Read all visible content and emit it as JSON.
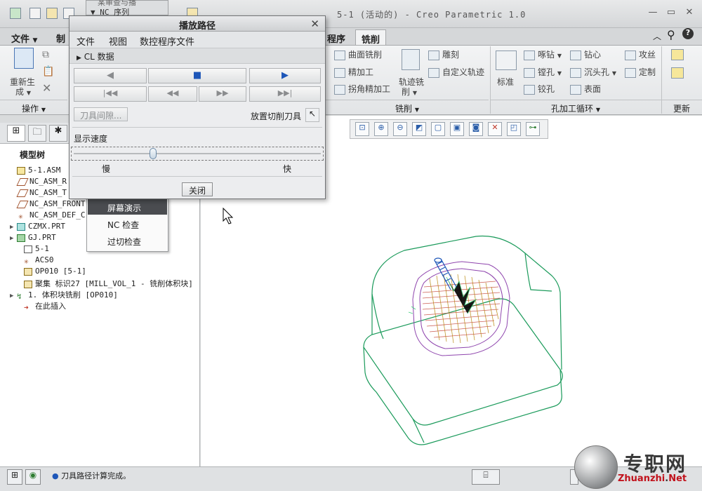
{
  "window": {
    "title": "5-1 (活动的) - Creo Parametric 1.0"
  },
  "ribbon": {
    "tabs": [
      {
        "label": "文件",
        "has_arrow": true
      },
      {
        "label": "制",
        "has_arrow": false
      },
      {
        "label": "程序",
        "has_arrow": false
      },
      {
        "label": "铣削",
        "has_arrow": false,
        "active": true
      }
    ],
    "regen_label_1": "重新生",
    "regen_label_2": "成",
    "operations_group": "操作",
    "milling_items": [
      "曲面铣削",
      "精加工",
      "拐角精加工"
    ],
    "trajectory_label_1": "轨迹铣",
    "trajectory_label_2": "削",
    "engrave_items": [
      "雕刻",
      "自定义轨迹"
    ],
    "milling_group": "铣削",
    "standard_label": "标准",
    "hole_col1": [
      "啄钻",
      "镗孔",
      "铰孔"
    ],
    "hole_col2": [
      "钻心",
      "沉头孔",
      "表面"
    ],
    "hole_col3": [
      "攻丝",
      "定制"
    ],
    "hole_group": "孔加工循环",
    "update_group": "更新"
  },
  "dialog": {
    "title": "播放路径",
    "menu": [
      "文件",
      "视图",
      "数控程序文件"
    ],
    "cl_data": "CL 数据",
    "tool_clearance": "刀具间隙...",
    "place_cutter": "放置切削刀具",
    "speed_label": "显示速度",
    "speed_slow": "慢",
    "speed_fast": "快",
    "speed_value": 0.32,
    "close": "关闭",
    "header_fragment": "NC 序列",
    "header_fragment_top": "某审查与播",
    "btn_icons": {
      "play_back": "◀",
      "stop": "■",
      "play": "▶",
      "first": "|◀◀",
      "rewind": "◀◀",
      "forward": "▶▶",
      "last": "▶▶|"
    }
  },
  "context_menu": {
    "items": [
      {
        "label": "屏幕演示",
        "selected": true
      },
      {
        "label": "NC 检查",
        "selected": false
      },
      {
        "label": "过切检查",
        "selected": false
      }
    ]
  },
  "model_tree": {
    "title": "模型树",
    "items": [
      {
        "label": "5-1.ASM",
        "icon": "assembly-icon",
        "expand": ""
      },
      {
        "label": "NC_ASM_R",
        "icon": "datum-plane-icon",
        "expand": ""
      },
      {
        "label": "NC_ASM_T",
        "icon": "datum-plane-icon",
        "expand": ""
      },
      {
        "label": "NC_ASM_FRONT",
        "icon": "datum-plane-icon",
        "expand": ""
      },
      {
        "label": "NC_ASM_DEF_C",
        "icon": "csys-icon",
        "expand": ""
      },
      {
        "label": "CZMX.PRT",
        "icon": "part-icon",
        "expand": "▶"
      },
      {
        "label": "GJ.PRT",
        "icon": "part-icon",
        "expand": "▶"
      },
      {
        "label": "5-1",
        "icon": "workcell-icon",
        "expand": ""
      },
      {
        "label": "ACS0",
        "icon": "csys-icon",
        "expand": ""
      },
      {
        "label": "OP010 [5-1]",
        "icon": "operation-icon",
        "expand": ""
      },
      {
        "label": "聚集 标识27 [MILL_VOL_1 - 铣削体积块]",
        "icon": "volume-icon",
        "expand": ""
      },
      {
        "label": "1. 体积块铣削 [OP010]",
        "icon": "nc-sequence-icon",
        "expand": "▶"
      },
      {
        "label": "在此插入",
        "icon": "insert-arrow-icon",
        "expand": ""
      }
    ]
  },
  "status_bar": {
    "message": "刀具路径计算完成。"
  },
  "watermark": {
    "cn": "专职网",
    "en_red": "Zhuanzhi",
    "en_dot": ".",
    "en_net": "Net"
  },
  "colors": {
    "accent": "#1d56b8",
    "part_outline": "#1a9a5a",
    "toolpath": "#b8860b",
    "toolpath_red": "#c0392b",
    "stock_outline": "#8e44ad"
  }
}
